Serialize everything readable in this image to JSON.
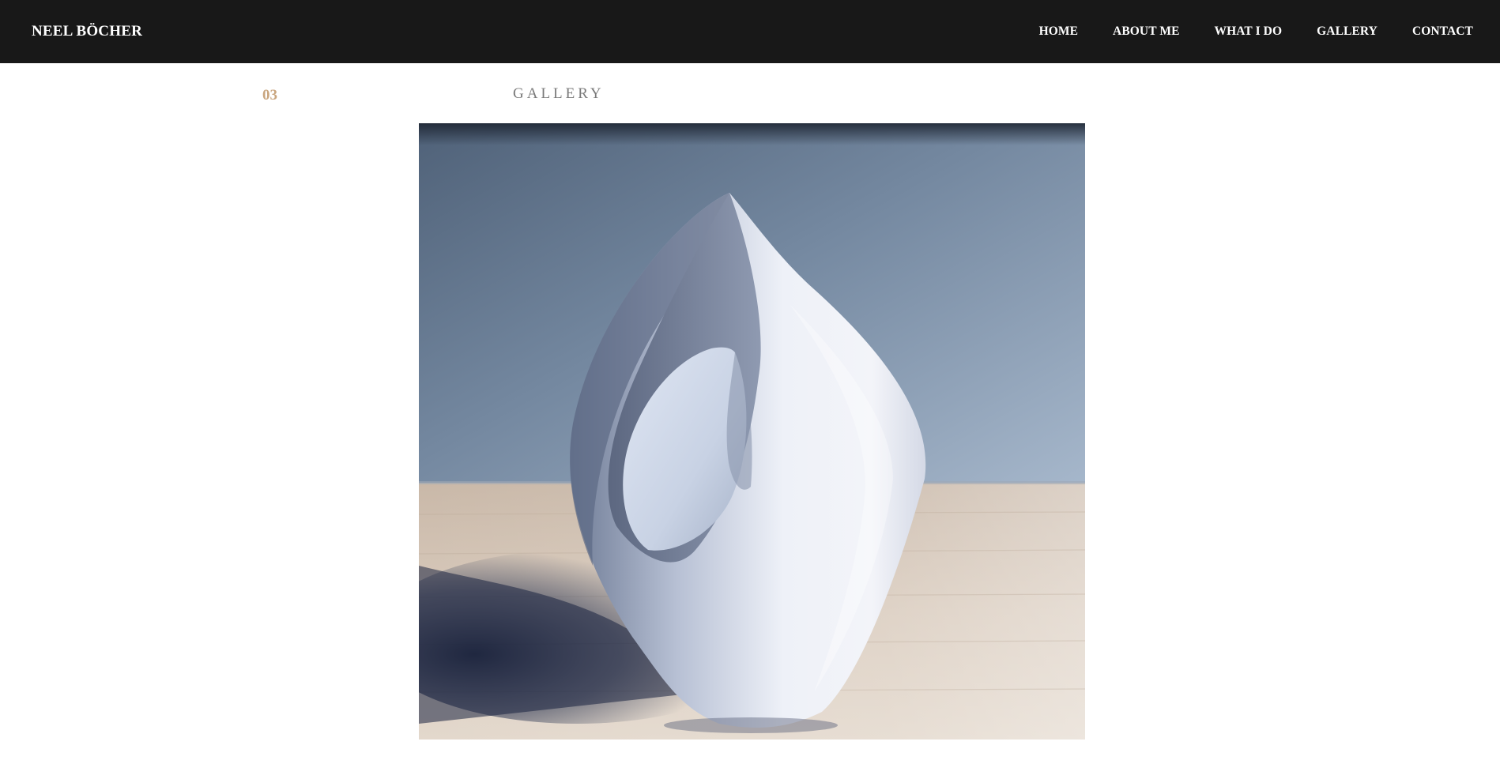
{
  "brand": "NEEL BÖCHER",
  "nav": {
    "home": "HOME",
    "about": "ABOUT ME",
    "what_i_do": "WHAT I DO",
    "gallery": "GALLERY",
    "contact": "CONTACT"
  },
  "section": {
    "number": "03",
    "title": "GALLERY"
  },
  "colors": {
    "navbar_bg": "#181818",
    "accent_number": "#c9a57e",
    "title_grey": "#7a7a7a"
  }
}
